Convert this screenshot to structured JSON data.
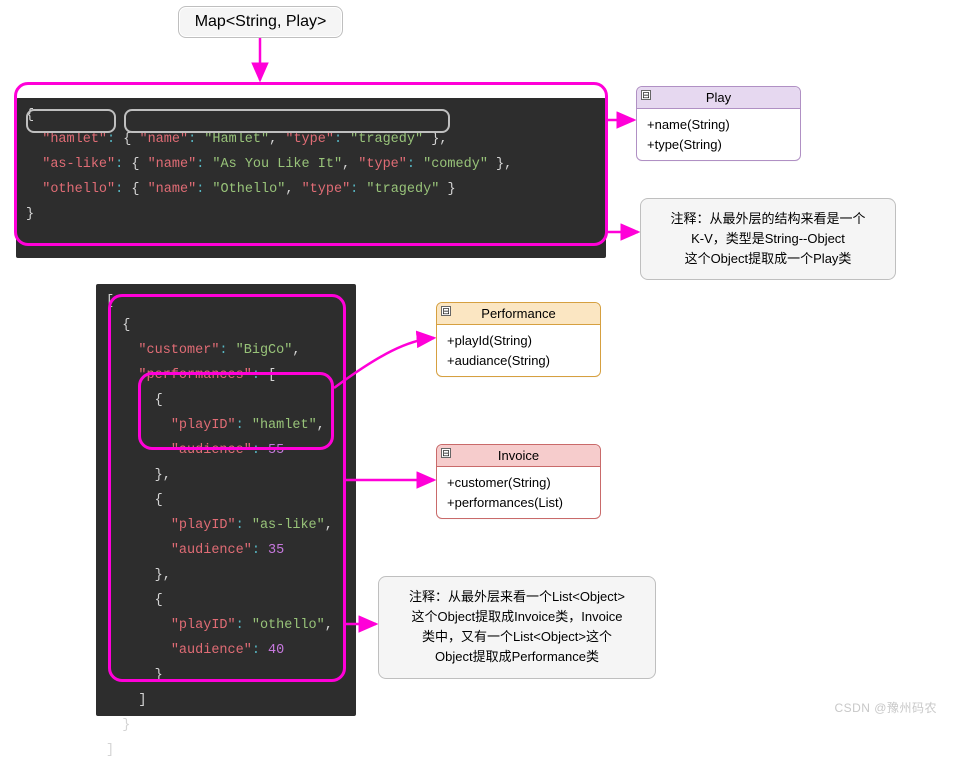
{
  "topBox": {
    "label": "Map<String, Play>"
  },
  "code1": {
    "entries": [
      {
        "key": "hamlet",
        "name": "Hamlet",
        "type": "tragedy"
      },
      {
        "key": "as-like",
        "name": "As You Like It",
        "type": "comedy"
      },
      {
        "key": "othello",
        "name": "Othello",
        "type": "tragedy"
      }
    ]
  },
  "code2": {
    "invoices": [
      {
        "customer": "BigCo",
        "performances": [
          {
            "playID": "hamlet",
            "audience": 55
          },
          {
            "playID": "as-like",
            "audience": 35
          },
          {
            "playID": "othello",
            "audience": 40
          }
        ]
      }
    ]
  },
  "classes": {
    "play": {
      "title": "Play",
      "members": [
        "+name(String)",
        "+type(String)"
      ]
    },
    "perf": {
      "title": "Performance",
      "members": [
        "+playId(String)",
        "+audiance(String)"
      ]
    },
    "invoice": {
      "title": "Invoice",
      "members": [
        "+customer(String)",
        "+performances(List)"
      ]
    }
  },
  "notes": {
    "n1": {
      "line1": "注释：从最外层的结构来看是一个",
      "line2": "K-V，类型是String--Object",
      "line3": "这个Object提取成一个Play类"
    },
    "n2": {
      "line1": "注释：从最外层来看一个List<Object>",
      "line2": "这个Object提取成Invoice类，Invoice",
      "line3": "类中，又有一个List<Object>这个",
      "line4": "Object提取成Performance类"
    }
  },
  "watermark": "CSDN @豫州码农",
  "collapse_glyph": "⊟"
}
